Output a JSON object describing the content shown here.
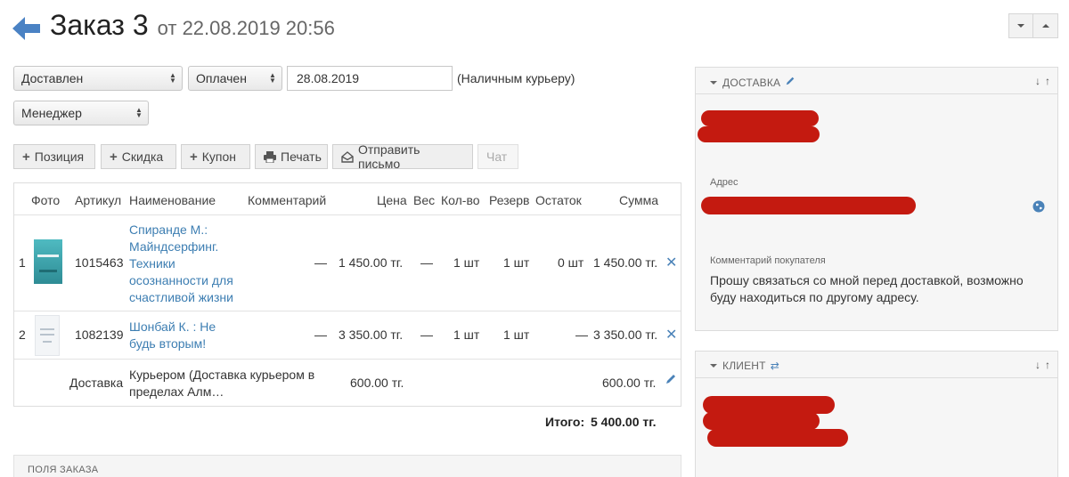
{
  "header": {
    "title": "Заказ 3",
    "date": "от 22.08.2019 20:56"
  },
  "controls": {
    "status_value": "Доставлен",
    "payment_value": "Оплачен",
    "date_value": "28.08.2019",
    "payment_method": "(Наличным курьеру)",
    "manager_value": "Менеджер"
  },
  "toolbar": {
    "position_label": "Позиция",
    "discount_label": "Скидка",
    "coupon_label": "Купон",
    "print_label": "Печать",
    "send_label": "Отправить письмо",
    "chat_label": "Чат"
  },
  "table": {
    "headers": {
      "photo": "Фото",
      "sku": "Артикул",
      "name": "Наименование",
      "comment": "Комментарий",
      "price": "Цена",
      "weight": "Вес",
      "qty": "Кол-во",
      "reserve": "Резерв",
      "stock": "Остаток",
      "sum": "Сумма"
    },
    "rows": [
      {
        "num": "1",
        "sku": "1015463",
        "name_lines": [
          "Спиранде М.:",
          "Майндсерфинг.",
          "Техники",
          "осознанности для",
          "счастливой жизни"
        ],
        "comment": "—",
        "price": "1 450.00 тг.",
        "weight": "—",
        "qty": "1 шт",
        "reserve": "1 шт",
        "stock": "0 шт",
        "sum": "1 450.00 тг."
      },
      {
        "num": "2",
        "sku": "1082139",
        "name_lines": [
          "Шонбай К. : Не",
          "будь вторым!"
        ],
        "comment": "—",
        "price": "3 350.00 тг.",
        "weight": "—",
        "qty": "1 шт",
        "reserve": "1 шт",
        "stock": "—",
        "sum": "3 350.00 тг."
      }
    ],
    "delivery": {
      "label": "Доставка",
      "name_lines": [
        "Курьером (Доставка курьером в",
        "пределах Алм…"
      ],
      "price": "600.00 тг.",
      "sum": "600.00 тг."
    }
  },
  "totals": {
    "label": "Итого:",
    "value": "5 400.00 тг."
  },
  "fields_section": {
    "title": "ПОЛЯ ЗАКАЗА"
  },
  "delivery_panel": {
    "title": "ДОСТАВКА",
    "address_label": "Адрес",
    "comment_label": "Комментарий покупателя",
    "comment_lines": [
      "Прошу связаться со мной перед доставкой, возможно",
      "буду находиться по другому адресу."
    ]
  },
  "client_panel": {
    "title": "КЛИЕНТ"
  },
  "colors": {
    "link": "#3d7eb2",
    "accent_blue": "#4a82b8",
    "redaction": "#c41a10"
  }
}
